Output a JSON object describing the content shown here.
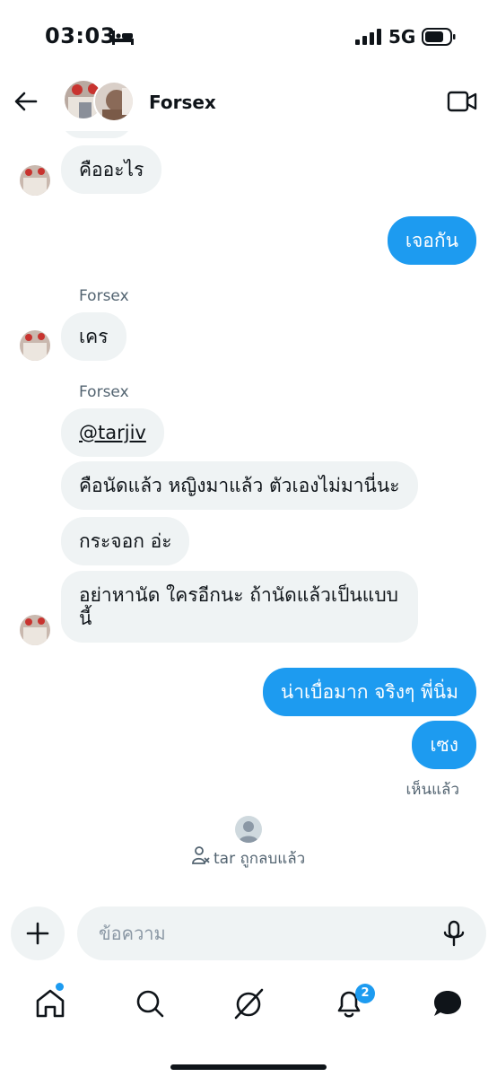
{
  "status_bar": {
    "time": "03:03",
    "network": "5G",
    "icons": [
      "bed-icon",
      "signal-icon",
      "battery-icon"
    ]
  },
  "header": {
    "title": "Forsex",
    "back_icon": "arrow-left-icon",
    "video_icon": "video-camera-icon"
  },
  "messages": [
    {
      "direction": "in",
      "text": "คืออะไร"
    },
    {
      "direction": "out",
      "text": "เจอกัน"
    },
    {
      "direction": "in",
      "sender": "Forsex",
      "text": "เคร"
    },
    {
      "direction": "in",
      "sender": "Forsex",
      "text": "@tarjiv"
    },
    {
      "direction": "in",
      "text": "คือนัดแล้ว  หญิงมาแล้ว ตัวเองไม่มานี่นะ"
    },
    {
      "direction": "in",
      "text": "กระจอก อ่ะ"
    },
    {
      "direction": "in",
      "text_line1": "อย่าหานัด ใครอีกนะ  ถ้านัดแล้วเป็นแบบ",
      "text_line2": "นี้"
    },
    {
      "direction": "out",
      "text": "น่าเบื่อมาก จริงๆ พี่นิ่ม"
    },
    {
      "direction": "out",
      "text": "เซง"
    }
  ],
  "seen_label": "เห็นแล้ว",
  "system_note": "tar ถูกลบแล้ว",
  "composer": {
    "placeholder": "ข้อความ"
  },
  "tab_bar": {
    "items": [
      "home-icon",
      "search-icon",
      "grok-icon",
      "bell-icon",
      "messages-icon"
    ],
    "notification_count": "2"
  },
  "colors": {
    "accent": "#1d9bf0",
    "bubble_in": "#eff3f4",
    "text": "#0f1419",
    "muted": "#536471"
  }
}
